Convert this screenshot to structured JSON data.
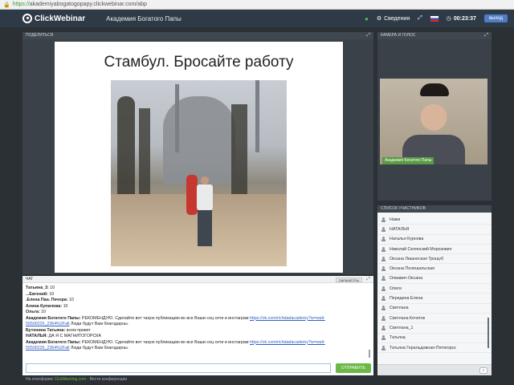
{
  "browser": {
    "url_https": "https://",
    "url_rest": "akademiyabogatogopapy.clickwebinar.com/abp"
  },
  "app": {
    "brand": "ClickWebinar",
    "webinar_title": "Академия Богатого Папы"
  },
  "toolbar": {
    "info_label": "Сведения",
    "timer": "00:23:37",
    "exit_label": "выход"
  },
  "present": {
    "header": "поделиться",
    "slide_title": "Стамбул. Бросайте работу"
  },
  "camera": {
    "header": "камера и голос",
    "name_label": "Академия  Богатого Папы"
  },
  "participants": {
    "header": "список участников",
    "items": [
      "Нажи",
      "НАТАЛЬЯ",
      "Наталья Курнова",
      "Николай Селянский Морозович",
      "Оксана Лишнеская Трошуб",
      "Оксана Полешальская",
      "Олиавич Оксана",
      "Олеги",
      "Передина Елена",
      "Светлана",
      "Светлана Кочоток",
      "Светлана_1",
      "Татьяна",
      "Татьяна Геральдовная-Пятигорск"
    ]
  },
  "chat": {
    "header": "чат",
    "options_label": "Параметры",
    "messages": [
      {
        "name": "Татьяна_3:",
        "text": " 10"
      },
      {
        "name": "...Евгений:",
        "text": " 10"
      },
      {
        "name": ".Елена Пан. Печора:",
        "text": " 10"
      },
      {
        "name": "Алина Купилова:",
        "text": " 10"
      },
      {
        "name": "Ольга:",
        "text": " 10"
      },
      {
        "name": "Академия  Богатого Папы:",
        "text": " РЕКОМЕНДУЮ. Сделайте вот такую публикацию во все Ваши соц сети и инстаграм ",
        "link": "https://vk.com/richdadacademy?w=wall-55500226_2364%2Fall",
        "tail": " Люди будут Вам благодарны."
      },
      {
        "name": "Бутенина Татьяна:",
        "text": " всем привет"
      },
      {
        "name": "НАТАЛЬЯ:",
        "text": " ДА Я С МАГНИТОГОРСКА"
      },
      {
        "name": "Академия  Богатого Папы:",
        "text": " РЕКОМЕНДУЮ. Сделайте вот такую публикацию во все Ваши соц сети и инстаграм ",
        "link": "https://vk.com/richdadacademy?w=wall-55500226_2364%2Fall",
        "tail": " Люди будут Вам благодарны."
      }
    ],
    "send_label": "ОТПРАВИТЬ"
  },
  "footer": {
    "prefix": "На платформе ",
    "brand": "ClickMeeting.com",
    "suffix": " - Вести конференции"
  }
}
